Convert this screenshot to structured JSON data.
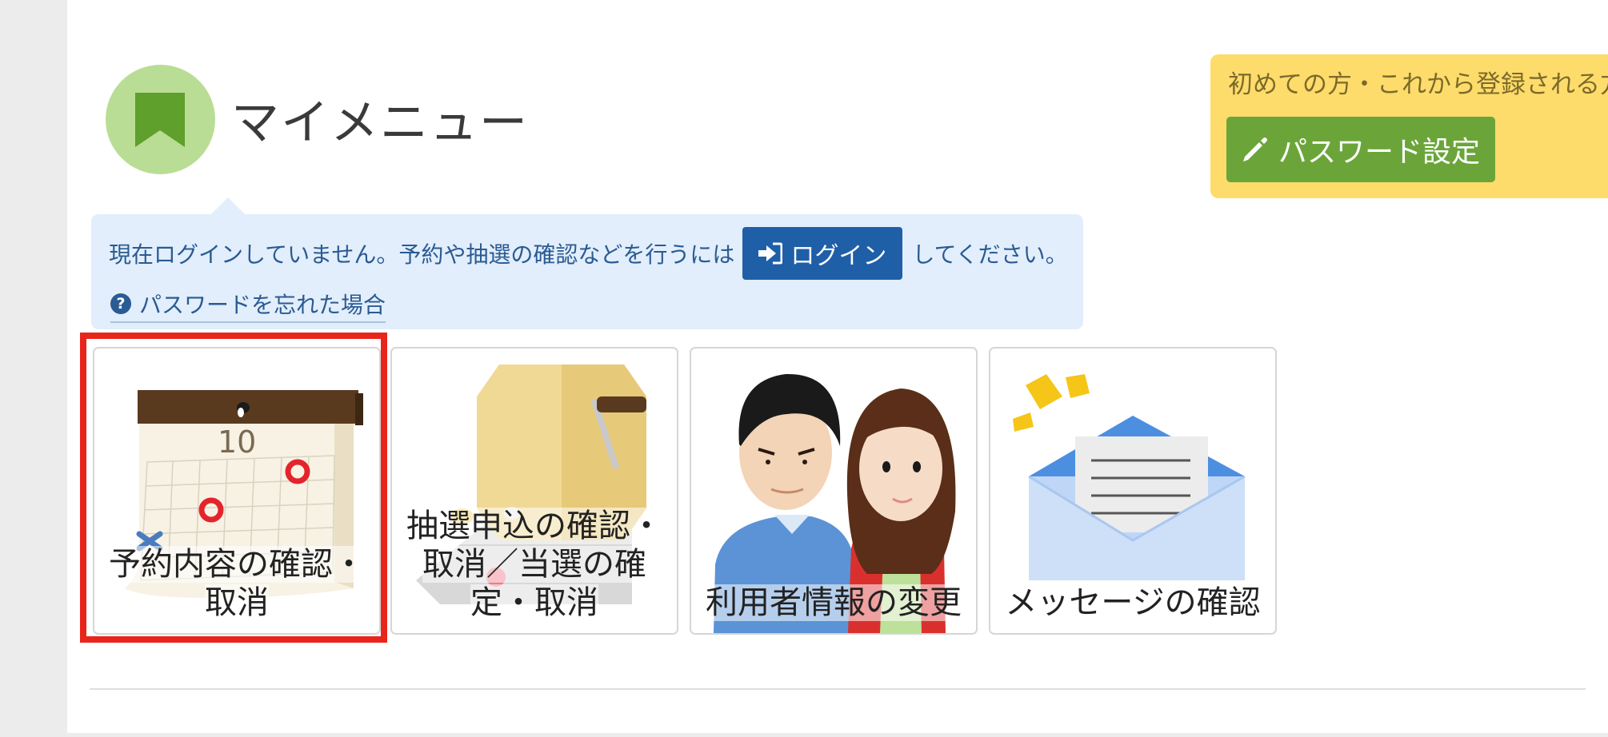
{
  "header": {
    "icon": "bookmark-icon",
    "title": "マイメニュー"
  },
  "first_time": {
    "text": "初めての方・これから登録される方",
    "button_label": "パスワード設定",
    "button_icon": "pencil-icon",
    "bg_color": "#fddc6b",
    "button_color": "#6ba53a"
  },
  "notice": {
    "text_before": "現在ログインしていません。予約や抽選の確認などを行うには",
    "login_label": "ログイン",
    "login_icon": "sign-in-icon",
    "text_after": "してください。",
    "forgot_label": "パスワードを忘れた場合",
    "forgot_icon": "question-circle-icon",
    "bg_color": "#e2eefb"
  },
  "cards": [
    {
      "label": "予約内容の確認・取消",
      "icon": "calendar-icon"
    },
    {
      "label": "抽選申込の確認・取消／当選の確定・取消",
      "icon": "lottery-drum-icon"
    },
    {
      "label": "利用者情報の変更",
      "icon": "users-icon"
    },
    {
      "label": "メッセージの確認",
      "icon": "envelope-icon"
    }
  ],
  "highlight_color": "#e8251b"
}
